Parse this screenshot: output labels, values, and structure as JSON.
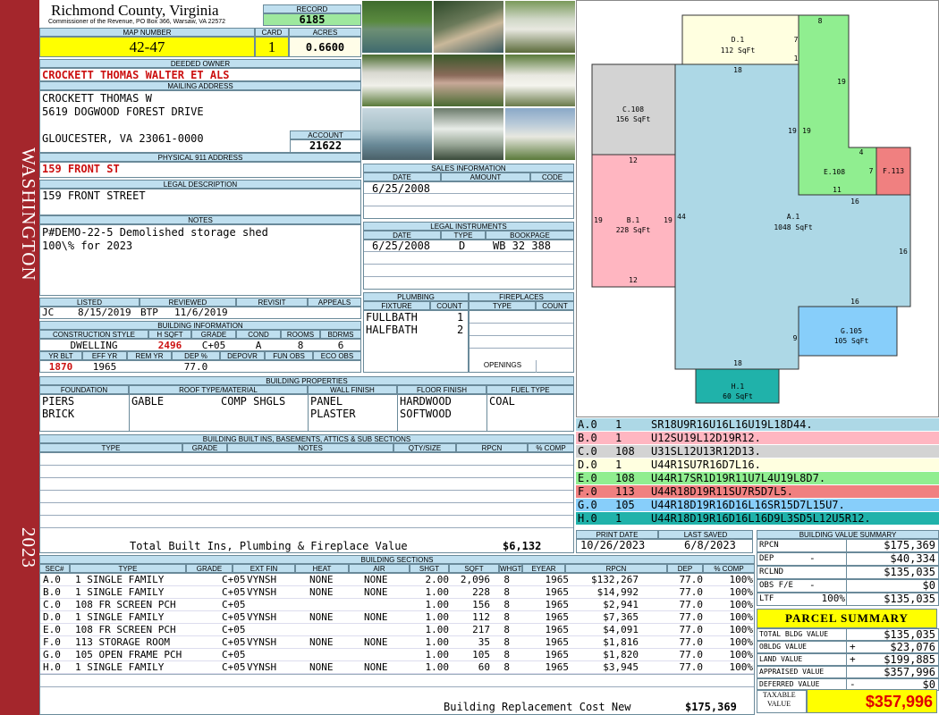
{
  "side": {
    "town": "WASHINGTON",
    "year": "2023"
  },
  "header": {
    "county": "Richmond County, Virginia",
    "address": "Commissioner of the Revenue, PO Box 366, Warsaw, VA 22572"
  },
  "record": {
    "label": "RECORD",
    "value": "6185"
  },
  "map": {
    "label": "MAP NUMBER",
    "value": "42-47",
    "card_label": "CARD",
    "card": "1",
    "acres_label": "ACRES",
    "acres": "0.6600"
  },
  "owner": {
    "label": "DEEDED OWNER",
    "value": "CROCKETT THOMAS WALTER ET ALS"
  },
  "mailing": {
    "label": "MAILING ADDRESS",
    "line1": "CROCKETT THOMAS W",
    "line2": "5619 DOGWOOD FOREST DRIVE",
    "line3": "GLOUCESTER, VA 23061-0000"
  },
  "account": {
    "label": "ACCOUNT",
    "value": "21622"
  },
  "physical": {
    "label": "PHYSICAL 911 ADDRESS",
    "value": "159 FRONT ST"
  },
  "legal": {
    "label": "LEGAL DESCRIPTION",
    "value": "159 FRONT STREET"
  },
  "notes": {
    "label": "NOTES",
    "line1": "P#DEMO-22-5 Demolished storage shed",
    "line2": "100\\% for 2023"
  },
  "sales": {
    "label": "SALES INFORMATION",
    "cols": [
      "DATE",
      "AMOUNT",
      "CODE"
    ],
    "rows": [
      [
        "6/25/2008",
        "",
        ""
      ]
    ]
  },
  "instruments": {
    "label": "LEGAL INSTRUMENTS",
    "cols": [
      "DATE",
      "TYPE",
      "BOOKPAGE"
    ],
    "rows": [
      [
        "6/25/2008",
        "D",
        "WB 32 388"
      ]
    ]
  },
  "review": {
    "cols": [
      "LISTED",
      "REVIEWED",
      "REVISIT",
      "APPEALS"
    ],
    "listed_by": "JC",
    "listed": "8/15/2019",
    "reviewed_by": "BTP",
    "reviewed": "11/6/2019",
    "revisit": "",
    "appeals": ""
  },
  "plumbing": {
    "label": "PLUMBING",
    "cols": [
      "FIXTURE",
      "COUNT"
    ],
    "rows": [
      [
        "FULLBATH",
        "1"
      ],
      [
        "HALFBATH",
        "2"
      ]
    ]
  },
  "fireplaces": {
    "label": "FIREPLACES",
    "cols": [
      "TYPE",
      "COUNT"
    ],
    "openings": "OPENINGS"
  },
  "building_info": {
    "label": "BUILDING INFORMATION",
    "cols": [
      "CONSTRUCTION STYLE",
      "H SQFT",
      "GRADE",
      "COND",
      "ROOMS",
      "BDRMS"
    ],
    "style": "DWELLING",
    "hsqft": "2496",
    "grade": "C+05",
    "cond": "A",
    "rooms": "8",
    "bdrms": "6",
    "cols2": [
      "YR BLT",
      "EFF YR",
      "REM YR",
      "DEP %",
      "DEPOVR",
      "FUN OBS",
      "ECO OBS"
    ],
    "yrblt": "1870",
    "effyr": "1965",
    "remyr": "",
    "dep": "77.0",
    "depovr": "",
    "funobs": "",
    "ecoobs": ""
  },
  "properties": {
    "label": "BUILDING PROPERTIES",
    "cols": [
      "FOUNDATION",
      "ROOF TYPE/MATERIAL",
      "WALL FINISH",
      "FLOOR FINISH",
      "FUEL TYPE"
    ],
    "foundation": [
      "PIERS",
      "BRICK"
    ],
    "roof_type": "GABLE",
    "roof_mat": "COMP SHGLS",
    "wall": [
      "PANEL",
      "PLASTER"
    ],
    "floor": [
      "HARDWOOD",
      "SOFTWOOD"
    ],
    "fuel": "COAL"
  },
  "builtins": {
    "label": "BUILDING BUILT INS, BASEMENTS, ATTICS & SUB SECTIONS",
    "cols": [
      "TYPE",
      "GRADE",
      "NOTES",
      "QTY/SIZE",
      "RPCN",
      "% COMP"
    ],
    "total_label": "Total Built Ins, Plumbing & Fireplace Value",
    "total": "$6,132"
  },
  "sketch": {
    "labels": [
      {
        "id": "D.1",
        "area": "112 SqFt"
      },
      {
        "id": "C.108",
        "area": "156 SqFt"
      },
      {
        "id": "B.1",
        "area": "228 SqFt"
      },
      {
        "id": "A.1",
        "area": "1048 SqFt"
      },
      {
        "id": "E.108",
        "area": ""
      },
      {
        "id": "F.113",
        "area": ""
      },
      {
        "id": "G.105",
        "area": "105 SqFt"
      },
      {
        "id": "H.1",
        "area": "60 SqFt"
      }
    ],
    "dims": [
      "8",
      "7",
      "1",
      "18",
      "19",
      "19",
      "19",
      "4",
      "7",
      "11",
      "12",
      "16",
      "19",
      "19",
      "44",
      "16",
      "12",
      "16",
      "9",
      "18"
    ]
  },
  "vectors": [
    {
      "code": "A.0",
      "n": "1",
      "v": "SR18U9R16U16L16U19L18D44.",
      "color": "#add8e6"
    },
    {
      "code": "B.0",
      "n": "1",
      "v": "U12SU19L12D19R12.",
      "color": "#ffb6c1"
    },
    {
      "code": "C.0",
      "n": "108",
      "v": "U31SL12U13R12D13.",
      "color": "#d3d3d3"
    },
    {
      "code": "D.0",
      "n": "1",
      "v": "U44R1SU7R16D7L16.",
      "color": "#ffffe0"
    },
    {
      "code": "E.0",
      "n": "108",
      "v": "U44R17SR1D19R11U7L4U19L8D7.",
      "color": "#90ee90"
    },
    {
      "code": "F.0",
      "n": "113",
      "v": "U44R18D19R11SU7R5D7L5.",
      "color": "#f08080"
    },
    {
      "code": "G.0",
      "n": "105",
      "v": "U44R18D19R16D16L16SR15D7L15U7.",
      "color": "#87cefa"
    },
    {
      "code": "H.0",
      "n": "1",
      "v": "U44R18D19R16D16L16D9L3SD5L12U5R12.",
      "color": "#20b2aa"
    }
  ],
  "print": {
    "print_label": "PRINT DATE",
    "print": "10/26/2023",
    "saved_label": "LAST SAVED",
    "saved": "6/8/2023"
  },
  "sections": {
    "label": "BUILDING SECTIONS",
    "cols": [
      "SEC#",
      "TYPE",
      "GRADE",
      "EXT FIN",
      "HEAT",
      "AIR",
      "SHGT",
      "SQFT",
      "WHGT",
      "EYEAR",
      "RPCN",
      "DEP",
      "% COMP"
    ],
    "rows": [
      [
        "A.0",
        "1 SINGLE FAMILY",
        "C+05",
        "VYNSH",
        "NONE",
        "NONE",
        "2.00",
        "2,096",
        "8",
        "1965",
        "$132,267",
        "77.0",
        "100%"
      ],
      [
        "B.0",
        "1 SINGLE FAMILY",
        "C+05",
        "VYNSH",
        "NONE",
        "NONE",
        "1.00",
        "228",
        "8",
        "1965",
        "$14,992",
        "77.0",
        "100%"
      ],
      [
        "C.0",
        "108 FR SCREEN PCH",
        "C+05",
        "",
        "",
        "",
        "1.00",
        "156",
        "8",
        "1965",
        "$2,941",
        "77.0",
        "100%"
      ],
      [
        "D.0",
        "1 SINGLE FAMILY",
        "C+05",
        "VYNSH",
        "NONE",
        "NONE",
        "1.00",
        "112",
        "8",
        "1965",
        "$7,365",
        "77.0",
        "100%"
      ],
      [
        "E.0",
        "108 FR SCREEN PCH",
        "C+05",
        "",
        "",
        "",
        "1.00",
        "217",
        "8",
        "1965",
        "$4,091",
        "77.0",
        "100%"
      ],
      [
        "F.0",
        "113 STORAGE ROOM",
        "C+05",
        "VYNSH",
        "NONE",
        "NONE",
        "1.00",
        "35",
        "8",
        "1965",
        "$1,816",
        "77.0",
        "100%"
      ],
      [
        "G.0",
        "105 OPEN FRAME PCH",
        "C+05",
        "",
        "",
        "",
        "1.00",
        "105",
        "8",
        "1965",
        "$1,820",
        "77.0",
        "100%"
      ],
      [
        "H.0",
        "1 SINGLE FAMILY",
        "C+05",
        "VYNSH",
        "NONE",
        "NONE",
        "1.00",
        "60",
        "8",
        "1965",
        "$3,945",
        "77.0",
        "100%"
      ]
    ],
    "total_label": "Building Replacement Cost New",
    "total": "$175,369"
  },
  "value_summary": {
    "label": "BUILDING VALUE SUMMARY",
    "rows": [
      [
        "RPCN",
        "",
        "$175,369"
      ],
      [
        "DEP",
        "-",
        "$40,334"
      ],
      [
        "RCLND",
        "",
        "$135,035"
      ],
      [
        "OBS F/E",
        "-",
        "$0"
      ],
      [
        "LTF",
        "100%",
        "$135,035"
      ]
    ]
  },
  "parcel": {
    "label": "PARCEL SUMMARY",
    "rows": [
      [
        "TOTAL BLDG VALUE",
        "",
        "$135,035"
      ],
      [
        "OBLDG VALUE",
        "+",
        "$23,076"
      ],
      [
        "LAND VALUE",
        "+",
        "$199,885"
      ],
      [
        "APPRAISED VALUE",
        "",
        "$357,996"
      ],
      [
        "DEFERRED VALUE",
        "-",
        "$0"
      ]
    ],
    "taxable_label1": "TAXABLE",
    "taxable_label2": "VALUE",
    "taxable": "$357,996"
  }
}
